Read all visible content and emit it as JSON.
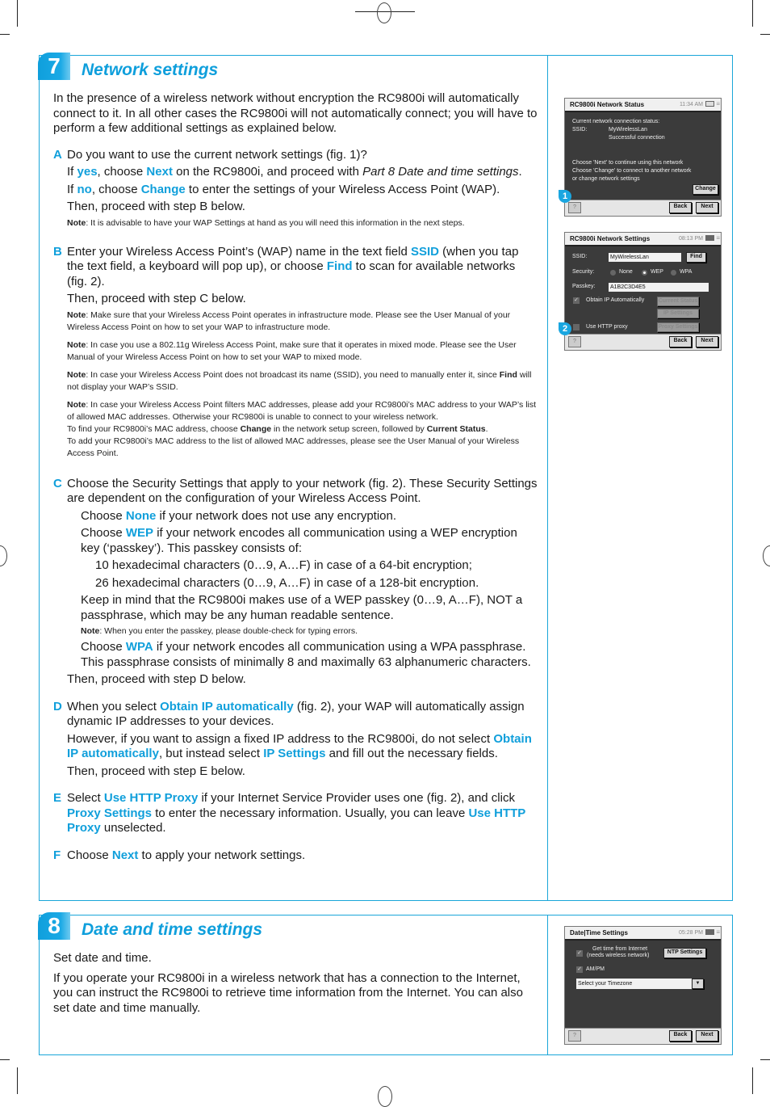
{
  "section7": {
    "number": "7",
    "title": "Network settings",
    "intro": "In the presence of a wireless network without encryption the RC9800i will automatically connect to it. In all other cases the RC9800i will not automatically connect; you will have to perform a few additional settings as explained below.",
    "stepA": {
      "letter": "A",
      "line1": "Do you want to use the current network settings (fig. 1)?",
      "yes_pre": "If ",
      "yes": "yes",
      "yes_mid": ", choose ",
      "next": "Next",
      "yes_post": " on the RC9800i, and proceed with ",
      "yes_ref": "Part 8 Date and time settings",
      "yes_end": ".",
      "no_pre": "If ",
      "no": "no",
      "no_mid": ", choose ",
      "change": "Change",
      "no_post": " to enter the settings of your Wireless Access Point (WAP).",
      "then": "Then, proceed with step B below.",
      "note_label": "Note",
      "note": ": It is advisable to have your WAP Settings at hand as you will need this information in the next steps."
    },
    "stepB": {
      "letter": "B",
      "t1": "Enter your Wireless Access Point’s (WAP) name in the text field ",
      "ssid": "SSID",
      "t2": " (when you tap the text field, a keyboard will pop up), or choose ",
      "find": "Find",
      "t3": " to scan for available networks (fig. 2).",
      "then": "Then, proceed with step C below.",
      "notes": [
        {
          "label": "Note",
          "text": ": Make sure that your Wireless Access Point operates in infrastructure mode. Please see the User Manual of your Wireless Access Point on how to set your WAP to infrastructure mode."
        },
        {
          "label": "Note",
          "text": ": In case you use a 802.11g Wireless Access Point, make sure that it operates in mixed mode. Please see the User Manual of your Wireless Access Point on how to set your WAP to mixed mode."
        }
      ],
      "note3_label": "Note",
      "note3_a": ": In case your Wireless Access Point does not broadcast its name (SSID), you need to manually enter it, since ",
      "note3_find": "Find",
      "note3_b": " will not display your WAP’s SSID.",
      "note4_label": "Note",
      "note4_a": ": In case your Wireless Access Point filters MAC addresses, please add your RC9800i’s MAC address to your WAP’s list of allowed MAC addresses. Otherwise your RC9800i is unable to connect to your wireless network.",
      "note4_b": "To find your RC9800i’s MAC address, choose ",
      "note4_change": "Change",
      "note4_c": " in the network setup screen, followed by ",
      "note4_status": "Current Status",
      "note4_d": ".",
      "note4_e": "To add your RC9800i’s MAC address to the list of allowed MAC addresses, please see the User Manual of your Wireless Access Point."
    },
    "stepC": {
      "letter": "C",
      "line1": "Choose the Security Settings that apply to your network (fig. 2). These Security Settings are dependent on the configuration of your Wireless Access Point.",
      "none_pre": "Choose ",
      "none": "None",
      "none_post": " if your network does not use any encryption.",
      "wep_pre": "Choose ",
      "wep": "WEP",
      "wep_post": " if your network encodes all communication using a WEP encryption key (‘passkey’). This passkey consists of:",
      "hex64": "10 hexadecimal characters (0…9, A…F) in case of a 64-bit encryption;",
      "hex128": "26 hexadecimal characters (0…9, A…F) in case of a 128-bit encryption.",
      "keep": "Keep in mind that the RC9800i makes use of a WEP passkey (0…9, A…F), NOT a passphrase, which may be any human readable sentence.",
      "note_label": "Note",
      "note": ": When you enter the passkey, please double-check for typing errors.",
      "wpa_pre": "Choose ",
      "wpa": "WPA",
      "wpa_post": " if your network encodes all communication using a WPA passphrase. This passphrase consists of minimally 8 and maximally 63 alphanumeric characters.",
      "then": "Then, proceed with step D below."
    },
    "stepD": {
      "letter": "D",
      "t1": "When you select ",
      "obtain": "Obtain IP automatically",
      "t2": " (fig. 2), your WAP will automatically assign dynamic IP addresses to your devices.",
      "t3": "However, if you want to assign a fixed IP address to the RC9800i, do not select ",
      "obtain2": "Obtain IP automatically",
      "t4": ", but instead select ",
      "ipset": "IP Settings",
      "t5": " and fill out the necessary fields.",
      "then": "Then, proceed with step E below."
    },
    "stepE": {
      "letter": "E",
      "t1": "Select ",
      "proxy": "Use HTTP Proxy",
      "t2": " if your Internet Service Provider uses one (fig. 2), and click ",
      "proxyset": "Proxy Settings",
      "t3": " to enter the necessary information. Usually, you can leave ",
      "proxy2": "Use HTTP Proxy",
      "t4": " unselected."
    },
    "stepF": {
      "letter": "F",
      "t1": "Choose ",
      "next": "Next",
      "t2": " to apply your network settings."
    }
  },
  "section8": {
    "number": "8",
    "title": "Date and time settings",
    "p1": "Set date and time.",
    "p2": "If you operate your RC9800i in a wireless network that has a connection to the Internet, you can instruct the RC9800i to retrieve time information from the Internet. You can also set date and time manually."
  },
  "fig1": {
    "number": "1",
    "title": "RC9800i Network Status",
    "time": "11:34 AM",
    "status_label": "Current network connection status:",
    "ssid_label": "SSID:",
    "ssid_value": "MyWirelessLan",
    "connection": "Successful connection",
    "msg1": "Choose 'Next' to continue using this network",
    "msg2": "Choose 'Change' to connect to another network",
    "msg3": "or change network settings",
    "change": "Change",
    "help": "?",
    "back": "Back",
    "next": "Next"
  },
  "fig2": {
    "number": "2",
    "title": "RC9800i Network Settings",
    "time": "08:13 PM",
    "ssid_label": "SSID:",
    "ssid_value": "MyWirelessLan",
    "find": "Find",
    "security_label": "Security:",
    "security_options": [
      "None",
      "WEP",
      "WPA"
    ],
    "security_selected": "WEP",
    "passkey_label": "Passkey:",
    "passkey_value": "A1B2C3D4E5",
    "obtain_ip": "Obtain IP Automatically",
    "obtain_ip_checked": true,
    "current_status": "Current Status",
    "ip_settings": "IP Settings",
    "use_proxy": "Use HTTP proxy",
    "use_proxy_checked": false,
    "proxy_settings": "Proxy Settings",
    "help": "?",
    "back": "Back",
    "next": "Next"
  },
  "fig3": {
    "title": "Date|Time Settings",
    "time": "05:28 PM",
    "get_time_1": "Get time from Internet",
    "get_time_2": "(needs wireless network)",
    "get_time_checked": true,
    "ntp": "NTP Settings",
    "ampm": "AM/PM",
    "ampm_checked": true,
    "timezone": "Select your Timezone",
    "help": "?",
    "back": "Back",
    "next": "Next"
  },
  "colors": {
    "accent": "#109fdb",
    "frame": "#1aa6d9",
    "device_bg": "#3b3b3b"
  }
}
